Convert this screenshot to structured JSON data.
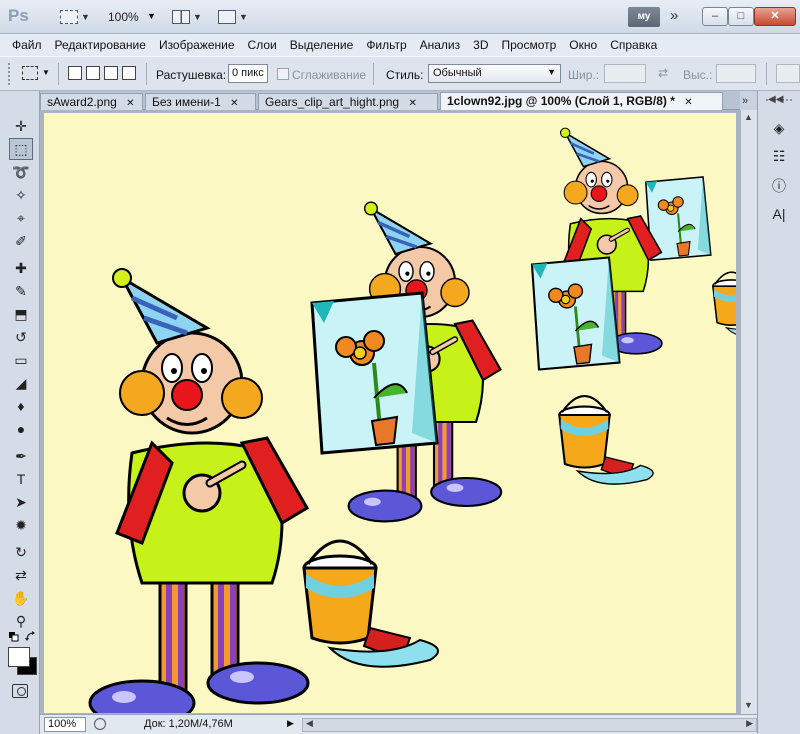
{
  "app": {
    "logo_text": "Ps",
    "zoom_level": "100%",
    "workspace_label": "му",
    "chevron": "»"
  },
  "window_controls": {
    "minimize": "–",
    "maximize": "□",
    "close": "✕"
  },
  "menu": [
    "Файл",
    "Редактирование",
    "Изображение",
    "Слои",
    "Выделение",
    "Фильтр",
    "Анализ",
    "3D",
    "Просмотр",
    "Окно",
    "Справка"
  ],
  "options": {
    "feather_label": "Растушевка:",
    "feather_value": "0 пикс",
    "antialias_label": "Сглаживание",
    "style_label": "Стиль:",
    "style_value": "Обычный",
    "width_label": "Шир.:",
    "height_label": "Выс.:"
  },
  "tabs": [
    {
      "label": "sAward2.png",
      "close": "✕",
      "active": false
    },
    {
      "label": "Без имени-1",
      "close": "✕",
      "active": false
    },
    {
      "label": "Gears_clip_art_hight.png",
      "close": "✕",
      "active": false
    },
    {
      "label": "1clown92.jpg @ 100% (Слой 1, RGB/8) *",
      "close": "✕",
      "active": true
    }
  ],
  "tab_overflow": "»",
  "tools": [
    {
      "name": "move-tool-icon",
      "glyph": "✛"
    },
    {
      "name": "rect-marquee-tool-icon",
      "glyph": "⬚"
    },
    {
      "name": "lasso-tool-icon",
      "glyph": "➰"
    },
    {
      "name": "magic-wand-tool-icon",
      "glyph": "✧"
    },
    {
      "name": "crop-tool-icon",
      "glyph": "⌖"
    },
    {
      "name": "eyedropper-tool-icon",
      "glyph": "✐"
    },
    {
      "name": "healing-brush-tool-icon",
      "glyph": "✚"
    },
    {
      "name": "brush-tool-icon",
      "glyph": "✎"
    },
    {
      "name": "clone-stamp-tool-icon",
      "glyph": "⬒"
    },
    {
      "name": "history-brush-tool-icon",
      "glyph": "↺"
    },
    {
      "name": "eraser-tool-icon",
      "glyph": "▭"
    },
    {
      "name": "paint-bucket-tool-icon",
      "glyph": "◢"
    },
    {
      "name": "blur-tool-icon",
      "glyph": "♦"
    },
    {
      "name": "dodge-tool-icon",
      "glyph": "●"
    },
    {
      "name": "pen-tool-icon",
      "glyph": "✒"
    },
    {
      "name": "type-tool-icon",
      "glyph": "T"
    },
    {
      "name": "path-selection-tool-icon",
      "glyph": "➤"
    },
    {
      "name": "custom-shape-tool-icon",
      "glyph": "✹"
    },
    {
      "name": "3d-rotate-tool-icon",
      "glyph": "↻"
    },
    {
      "name": "3d-orbit-tool-icon",
      "glyph": "⇄"
    },
    {
      "name": "hand-tool-icon",
      "glyph": "✋"
    },
    {
      "name": "zoom-tool-icon",
      "glyph": "⚲"
    }
  ],
  "colors": {
    "foreground": "#ffffff",
    "background": "#000000",
    "canvas": "#fbf8c4"
  },
  "status": {
    "zoom": "100%",
    "doc_info": "Док: 1,20M/4,76M"
  },
  "right_panel": [
    {
      "name": "layers-panel-icon",
      "glyph": "◈"
    },
    {
      "name": "channels-panel-icon",
      "glyph": "☷"
    },
    {
      "name": "info-panel-icon",
      "glyph": "ⓘ"
    },
    {
      "name": "character-panel-icon",
      "glyph": "A|"
    }
  ]
}
